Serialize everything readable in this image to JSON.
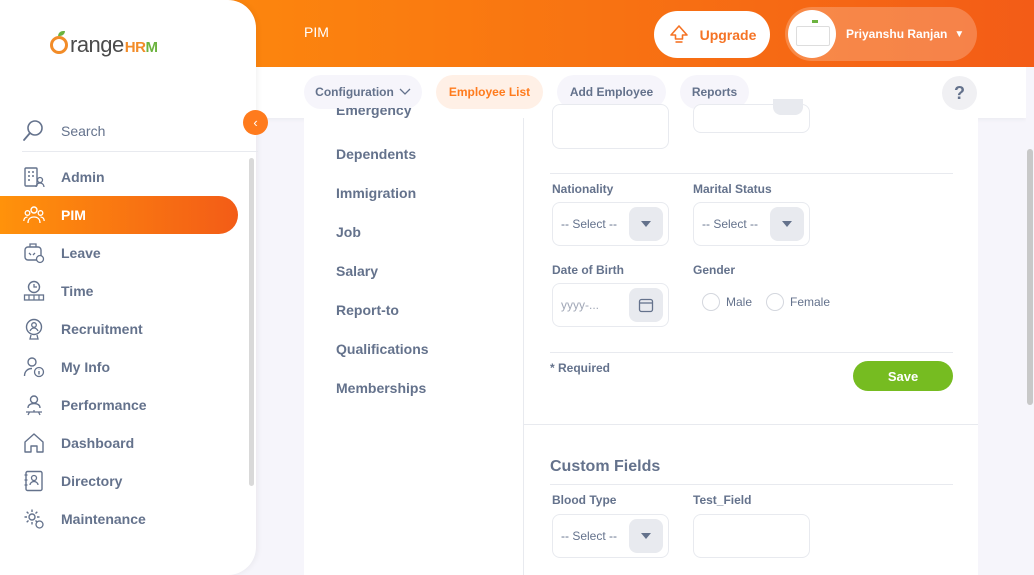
{
  "brand": {
    "logo_main": "range",
    "logo_hrm_a": "HR",
    "logo_hrm_b": "M",
    "accent": "#ff7b1d",
    "green": "#76bc21"
  },
  "sidebar": {
    "search_label": "Search",
    "items": [
      {
        "label": "Admin",
        "icon": "admin-icon"
      },
      {
        "label": "PIM",
        "icon": "pim-icon",
        "active": true
      },
      {
        "label": "Leave",
        "icon": "leave-icon"
      },
      {
        "label": "Time",
        "icon": "time-icon"
      },
      {
        "label": "Recruitment",
        "icon": "recruitment-icon"
      },
      {
        "label": "My Info",
        "icon": "my-info-icon"
      },
      {
        "label": "Performance",
        "icon": "performance-icon"
      },
      {
        "label": "Dashboard",
        "icon": "dashboard-icon"
      },
      {
        "label": "Directory",
        "icon": "directory-icon"
      },
      {
        "label": "Maintenance",
        "icon": "maintenance-icon"
      }
    ]
  },
  "header": {
    "module_title": "PIM",
    "upgrade_label": "Upgrade",
    "user_name": "Priyanshu Ranjan"
  },
  "tabs": [
    {
      "label": "Configuration",
      "has_caret": true
    },
    {
      "label": "Employee List",
      "active": true
    },
    {
      "label": "Add Employee"
    },
    {
      "label": "Reports"
    }
  ],
  "help_label": "?",
  "left_menu": {
    "partial_item": "Emergency Contacts",
    "items": [
      "Dependents",
      "Immigration",
      "Job",
      "Salary",
      "Report-to",
      "Qualifications",
      "Memberships"
    ]
  },
  "form": {
    "nationality_label": "Nationality",
    "nationality_value": "-- Select --",
    "marital_label": "Marital Status",
    "marital_value": "-- Select --",
    "dob_label": "Date of Birth",
    "dob_placeholder": "yyyy-...",
    "gender_label": "Gender",
    "gender_male": "Male",
    "gender_female": "Female",
    "required_note": "* Required",
    "save_label": "Save"
  },
  "custom_fields": {
    "title": "Custom Fields",
    "blood_type_label": "Blood Type",
    "blood_type_value": "-- Select --",
    "test_field_label": "Test_Field"
  }
}
